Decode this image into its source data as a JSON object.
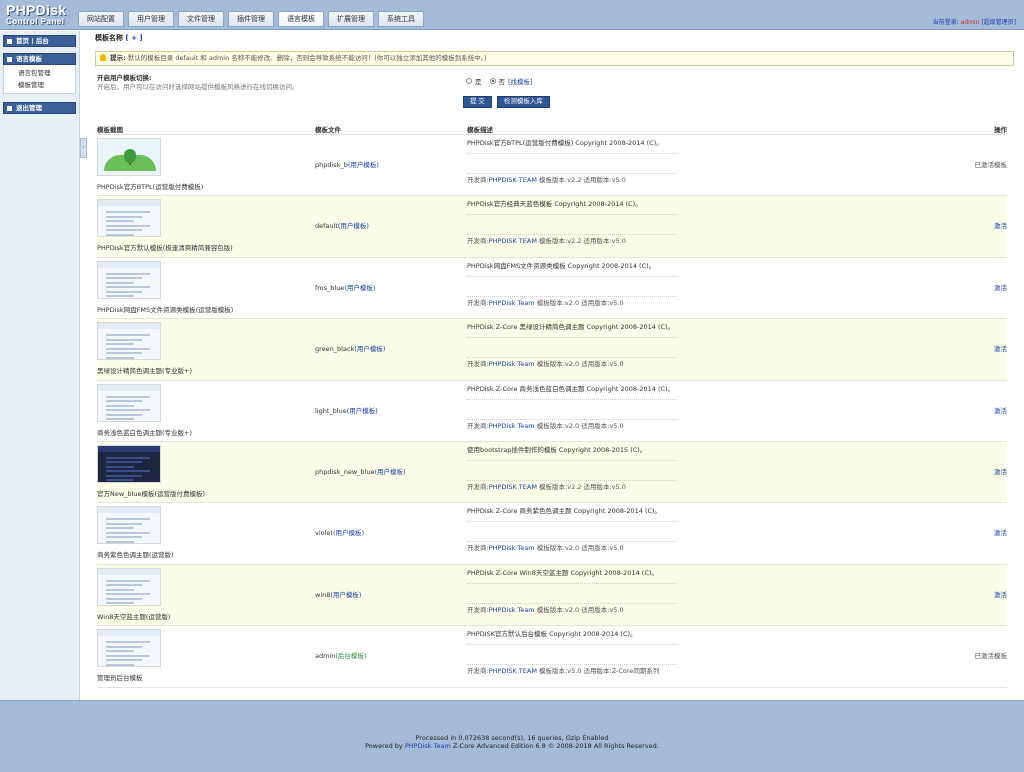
{
  "header": {
    "logo_line1": "PHPDisk",
    "logo_line2": "Control Panel",
    "tabs": [
      {
        "label": "网站配置"
      },
      {
        "label": "用户管理"
      },
      {
        "label": "文件管理"
      },
      {
        "label": "插件管理"
      },
      {
        "label": "语言模板"
      },
      {
        "label": "扩展管理"
      },
      {
        "label": "系统工具"
      }
    ],
    "active_tab": "语言模板",
    "login_prefix": "当前登录:",
    "login_user": "admin",
    "login_role": "[超级管理员]"
  },
  "sidebar": {
    "groups": [
      {
        "title": "首页 | 后台",
        "items": []
      },
      {
        "title": "语言模板",
        "items": [
          {
            "label": "语言包管理"
          },
          {
            "label": "模板管理"
          }
        ]
      },
      {
        "title": "退出管理",
        "items": []
      }
    ],
    "collapse_glyph": "‹"
  },
  "main": {
    "page_title": "模板名称",
    "page_title_add": "[ + ]",
    "tip_label": "提示:",
    "tip_text": "默认的模板目录 default 和 admin 名称不能修改、删除，否则会导致系统不能访问！(你可以独立添加其他的模板到系统中。)",
    "switch_label": "开启用户模板切换:",
    "switch_desc": "开启后，用户可以在访问时选择网站提供模板风格进行在线切换访问。",
    "radio_yes": "是",
    "radio_no": "否",
    "radio_selected": "否",
    "find_templates_link": "[找模板]",
    "submit_button": "提 交",
    "check_button": "检测模板入库",
    "columns": {
      "thumb": "模板截图",
      "file": "模板文件",
      "desc": "模板描述",
      "action": "操作"
    },
    "dev_label": "开发商:",
    "ver_label": "模板版本:",
    "app_label": "适用版本:",
    "rows": [
      {
        "name": "PHPDisk官方BTPL(运营版付费模板)",
        "dir": "phpdisk_b",
        "type": "(用户模板)",
        "type_kind": "user",
        "desc": "PHPDisk官方BTPL(运营版付费模板) Copyright 2008-2014 (C)。",
        "dev": "PHPDISK TEAM",
        "ver": "v2.2",
        "app": "v5.0",
        "action": "已激活模板",
        "action_kind": "active",
        "thumb": "pic",
        "alt": false
      },
      {
        "name": "PHPDisk官方默认模板(极速清爽精简兼容包版)",
        "dir": "default",
        "type": "(用户模板)",
        "type_kind": "user",
        "desc": "PHPDisk官方经典天蓝色模板 Copyright 2008-2014 (C)。",
        "dev": "PHPDISK TEAM",
        "ver": "v2.2",
        "app": "v5.0",
        "action": "激活",
        "action_kind": "link",
        "thumb": "light",
        "alt": true
      },
      {
        "name": "PHPDisk网盘FMS文件资源类模板(运营版模板)",
        "dir": "fms_blue",
        "type": "(用户模板)",
        "type_kind": "user",
        "desc": "PHPDisk网盘FMS文件资源类模板 Copyright 2008-2014 (C)。",
        "dev": "PHPDisk Team",
        "ver": "v2.0",
        "app": "v5.0",
        "action": "激活",
        "action_kind": "link",
        "thumb": "light",
        "alt": false
      },
      {
        "name": "黑绿设计精简色调主题(专业版+)",
        "dir": "green_black",
        "type": "(用户模板)",
        "type_kind": "user",
        "desc": "PHPDisk Z-Core 黑绿设计精简色调主题 Copyright 2008-2014 (C)。",
        "dev": "PHPDisk Team",
        "ver": "v2.0",
        "app": "v5.0",
        "action": "激活",
        "action_kind": "link",
        "thumb": "light",
        "alt": true
      },
      {
        "name": "商务浅色蓝白色调主题(专业版+)",
        "dir": "light_blue",
        "type": "(用户模板)",
        "type_kind": "user",
        "desc": "PHPDisk Z-Core 商务浅色蓝白色调主题 Copyright 2008-2014 (C)。",
        "dev": "PHPDisk Team",
        "ver": "v2.0",
        "app": "v5.0",
        "action": "激活",
        "action_kind": "link",
        "thumb": "light",
        "alt": false
      },
      {
        "name": "官方New_blue模板(运营版付费模板)",
        "dir": "phpdisk_new_blue",
        "type": "(用户模板)",
        "type_kind": "user",
        "desc": "使用bootstrap插件制作的模板 Copyright 2008-2015 (C)。",
        "dev": "PHPDISK TEAM",
        "ver": "v2.2",
        "app": "v5.0",
        "action": "激活",
        "action_kind": "link",
        "thumb": "dark",
        "alt": true
      },
      {
        "name": "商务紫色色调主题(运营版)",
        "dir": "violet",
        "type": "(用户模板)",
        "type_kind": "user",
        "desc": "PHPDisk Z-Core 商务紫色色调主题 Copyright 2008-2014 (C)。",
        "dev": "PHPDisk Team",
        "ver": "v2.0",
        "app": "v5.0",
        "action": "激活",
        "action_kind": "link",
        "thumb": "light",
        "alt": false
      },
      {
        "name": "Win8天空蓝主题(运营版)",
        "dir": "win8",
        "type": "(用户模板)",
        "type_kind": "user",
        "desc": "PHPDisk Z-Core Win8天空蓝主题 Copyright 2008-2014 (C)。",
        "dev": "PHPDisk Team",
        "ver": "v2.0",
        "app": "v5.0",
        "action": "激活",
        "action_kind": "link",
        "thumb": "light",
        "alt": true
      },
      {
        "name": "管理员后台模板",
        "dir": "admin",
        "type": "(后台模板)",
        "type_kind": "admin",
        "desc": "PHPDISK官方默认后台模板 Copyright 2008-2014 (C)。",
        "dev": "PHPDISK TEAM",
        "ver": "v5.0",
        "app": "Z-Core同期系列",
        "action": "已激活模板",
        "action_kind": "active",
        "thumb": "light",
        "alt": false
      }
    ]
  },
  "footer": {
    "line1": "Processed in 0.072638 second(s), 16 queries, Gzip Enabled",
    "line2_prefix": "Powered by ",
    "line2_brand": "PHPDisk Team",
    "line2_suffix": " Z-Core Advanced Edition 6.8 © 2008-2018 All Rights Reserved."
  }
}
